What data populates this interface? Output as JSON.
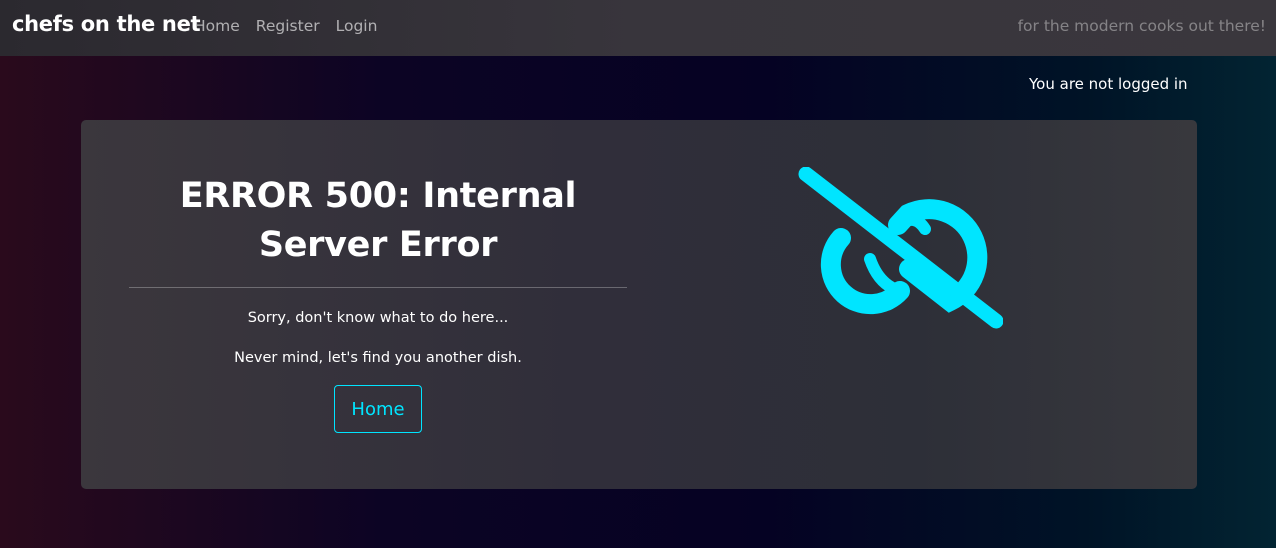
{
  "navbar": {
    "brand": "chefs on the net",
    "links": [
      {
        "label": "Home"
      },
      {
        "label": "Register"
      },
      {
        "label": "Login"
      }
    ],
    "tagline": "for the modern cooks out there!"
  },
  "status": {
    "login_text": "You are not logged in"
  },
  "error": {
    "title": "ERROR 500: Internal Server Error",
    "message_1": "Sorry, don't know what to do here...",
    "message_2": "Never mind, let's find you another dish.",
    "home_button_label": "Home"
  },
  "icons": {
    "error_logo": "broken-link-icon"
  },
  "colors": {
    "accent": "#00e5ff",
    "navbar_bg": "#35323a",
    "card_bg": "#333039"
  }
}
